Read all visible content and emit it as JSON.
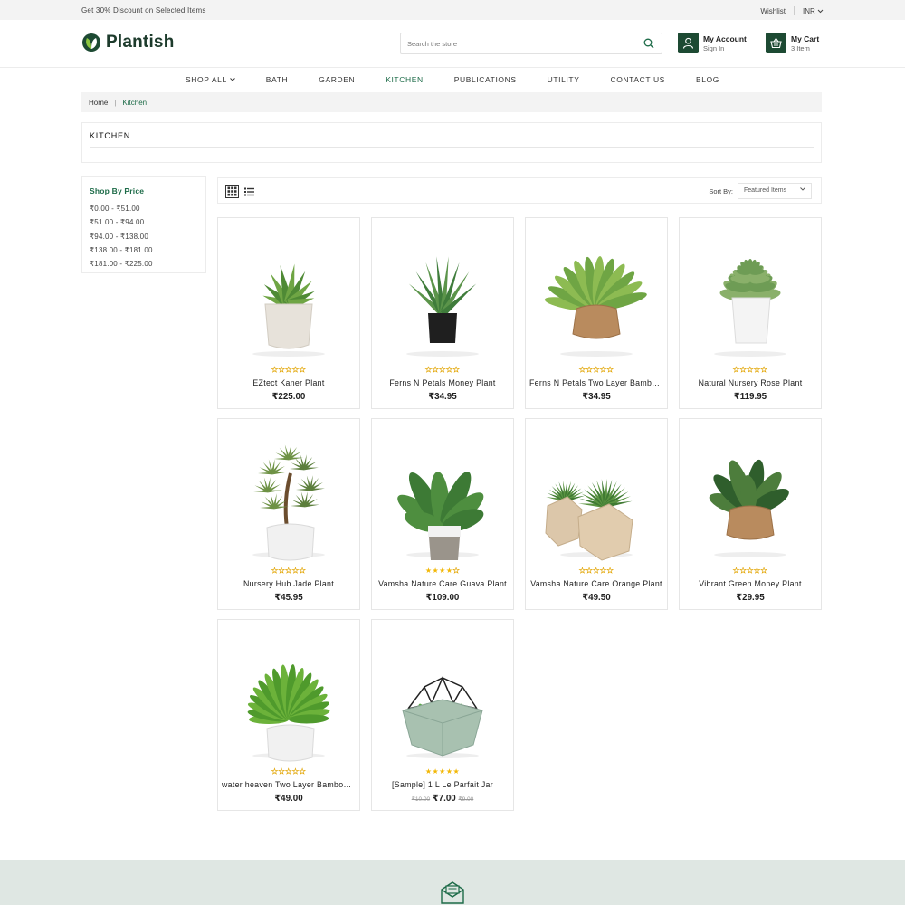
{
  "topbar": {
    "promo": "Get 30% Discount on Selected Items",
    "wishlist": "Wishlist",
    "currency": "INR"
  },
  "header": {
    "brand": "Plantish",
    "search_placeholder": "Search the store",
    "account": {
      "title": "My Account",
      "sub": "Sign In"
    },
    "cart": {
      "title": "My Cart",
      "sub": "3 Item"
    },
    "brand_color": "#1d4a33"
  },
  "nav": [
    "SHOP ALL",
    "BATH",
    "GARDEN",
    "KITCHEN",
    "PUBLICATIONS",
    "UTILITY",
    "CONTACT US",
    "BLOG"
  ],
  "nav_active": "KITCHEN",
  "breadcrumb": {
    "home": "Home",
    "separator": "|",
    "current": "Kitchen"
  },
  "category_title": "KITCHEN",
  "sidebar": {
    "title": "Shop By Price",
    "ranges": [
      "₹0.00 - ₹51.00",
      "₹51.00 - ₹94.00",
      "₹94.00 - ₹138.00",
      "₹138.00 - ₹181.00",
      "₹181.00 - ₹225.00"
    ]
  },
  "toolbar": {
    "sort_label": "Sort By:",
    "sort_value": "Featured Items"
  },
  "products": [
    {
      "name": "EZtect Kaner Plant",
      "price": "₹225.00",
      "rating": 0,
      "plant": "agave",
      "pot": "stone"
    },
    {
      "name": "Ferns N Petals Money Plant",
      "price": "₹34.95",
      "rating": 0,
      "plant": "aloe",
      "pot": "black"
    },
    {
      "name": "Ferns N Petals Two Layer Bamboo Plant",
      "price": "₹34.95",
      "rating": 0,
      "plant": "fern",
      "pot": "burlap"
    },
    {
      "name": "Natural Nursery Rose Plant",
      "price": "₹119.95",
      "rating": 0,
      "plant": "rosette",
      "pot": "white-square"
    },
    {
      "name": "Nursery Hub Jade Plant",
      "price": "₹45.95",
      "rating": 0,
      "plant": "pine",
      "pot": "white-round"
    },
    {
      "name": "Vamsha Nature Care Guava Plant",
      "price": "₹109.00",
      "rating": 4,
      "plant": "banana",
      "pot": "banded"
    },
    {
      "name": "Vamsha Nature Care Orange Plant",
      "price": "₹49.50",
      "rating": 0,
      "plant": "succulent-pair",
      "pot": "wood"
    },
    {
      "name": "Vibrant Green Money Plant",
      "price": "₹29.95",
      "rating": 0,
      "plant": "calathea",
      "pot": "burlap"
    },
    {
      "name": "water heaven Two Layer Bamboo Plant",
      "price": "₹49.00",
      "rating": 0,
      "plant": "fern-bushy",
      "pot": "white-round"
    },
    {
      "name": "[Sample] 1 L Le Parfait Jar",
      "price": "₹7.00",
      "price_old_left": "₹10.00",
      "price_old_right": "₹9.00",
      "rating": 5,
      "plant": "terrarium",
      "pot": "terrarium"
    }
  ],
  "icons": {
    "search": "search-icon",
    "account": "user-icon",
    "cart": "basket-icon",
    "grid_view": "grid-view-icon",
    "list_view": "list-view-icon",
    "newsletter": "mail-icon"
  }
}
